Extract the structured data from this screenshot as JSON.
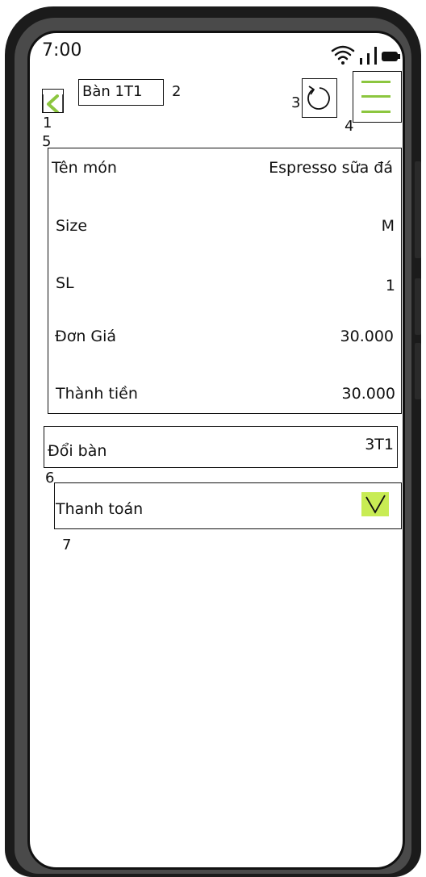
{
  "status_bar": {
    "time": "7:00",
    "icons": [
      "wifi-icon",
      "signal-icon",
      "battery-icon"
    ]
  },
  "header": {
    "back_icon": "chevron-left-icon",
    "table_label": "Bàn 1T1",
    "refresh_icon": "refresh-icon",
    "menu_icon": "hamburger-menu-icon"
  },
  "callouts": {
    "n1": "1",
    "n2": "2",
    "n3": "3",
    "n4": "4",
    "n5": "5",
    "n6": "6",
    "n7": "7"
  },
  "order_detail": {
    "rows": [
      {
        "label": "Tên món",
        "value": "Espresso sữa đá"
      },
      {
        "label": "Size",
        "value": "M"
      },
      {
        "label": "SL",
        "value": "1"
      },
      {
        "label": "Đơn Giá",
        "value": "30.000"
      },
      {
        "label": "Thành tiền",
        "value": "30.000"
      }
    ]
  },
  "change_table": {
    "label": "Đổi bàn",
    "value": "3T1"
  },
  "payment": {
    "label": "Thanh toán",
    "checked": true,
    "check_icon": "checkmark-icon"
  },
  "colors": {
    "accent": "#8cc63f",
    "check_fill": "#c8ec54",
    "border": "#111111"
  }
}
